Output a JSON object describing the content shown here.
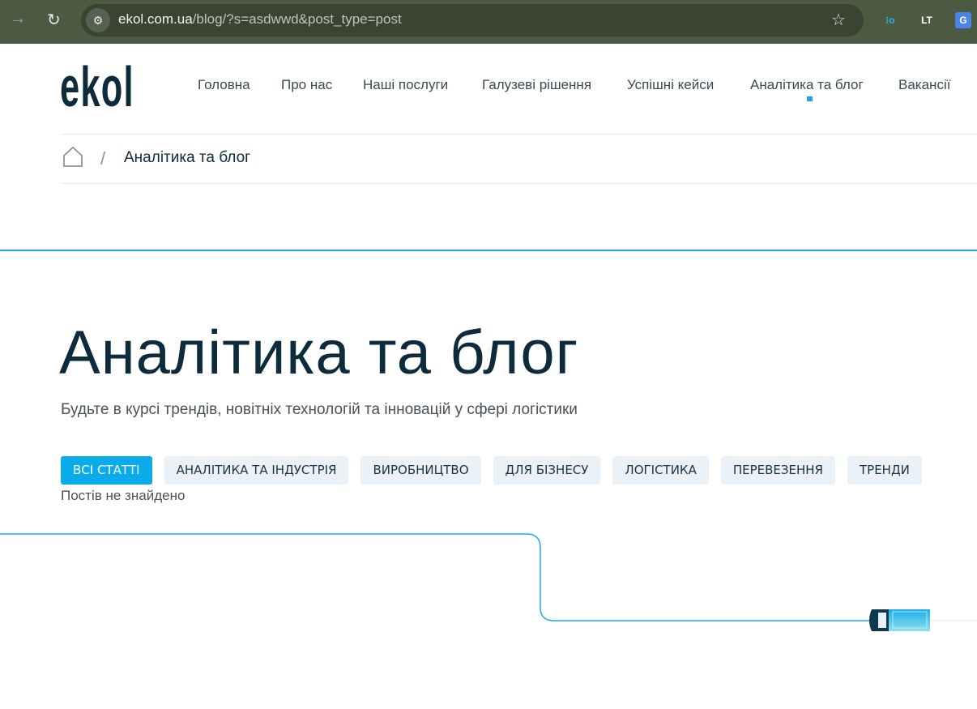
{
  "browser": {
    "url_host": "ekol.com.ua",
    "url_rest": "/blog/?s=asdwwd&post_type=post",
    "icons": [
      "forward-icon",
      "reload-icon",
      "site-settings-icon",
      "bookmark-star-icon",
      "extension-icon",
      "languagetool-icon",
      "google-translate-icon"
    ]
  },
  "header": {
    "logo": "ekol",
    "nav": [
      "Головна",
      "Про нас",
      "Наші послуги",
      "Галузеві рішення",
      "Успішні кейси",
      "Аналітика та блог",
      "Вакансії"
    ],
    "active_nav": "Аналітика та блог"
  },
  "breadcrumb": {
    "separator": "/",
    "current": "Аналітика та блог"
  },
  "main": {
    "title": "Аналітика та блог",
    "subtitle": "Будьте в курсі трендів, новітніх технологій та інновацій у сфері логістики",
    "tabs": [
      "ВСІ СТАТТІ",
      "АНАЛІТИКА ТА ІНДУСТРІЯ",
      "ВИРОБНИЦТВО",
      "ДЛЯ БІЗНЕСУ",
      "ЛОГІСТИКА",
      "ПЕРЕВЕЗЕННЯ",
      "ТРЕНДИ"
    ],
    "active_tab": "ВСІ СТАТТІ",
    "empty_message": "Постів не знайдено"
  },
  "colors": {
    "accent": "#0aabe9",
    "dark": "#0d2b3a"
  }
}
